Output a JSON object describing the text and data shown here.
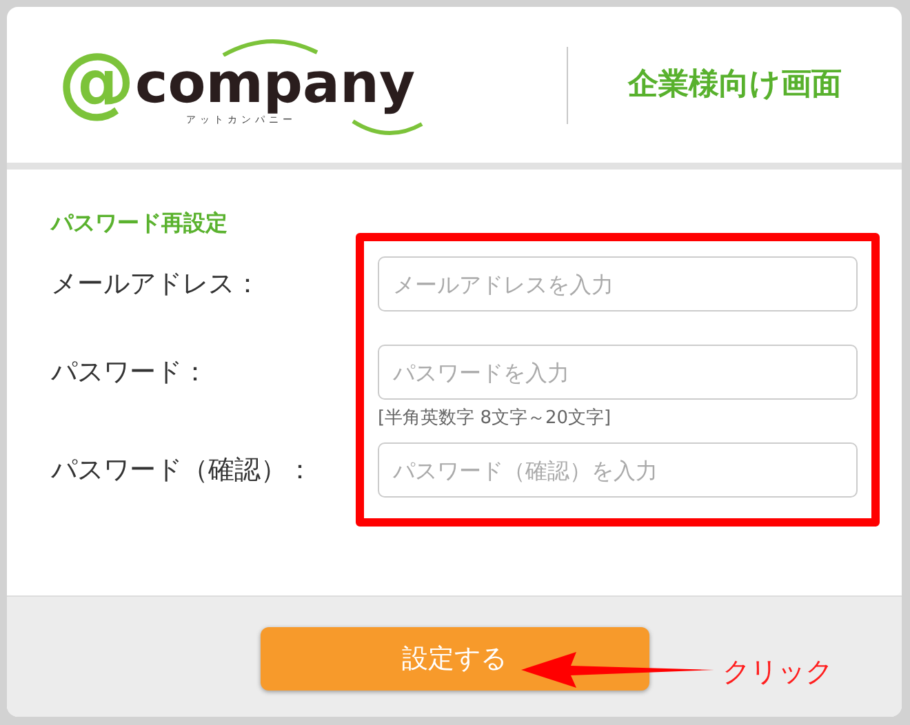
{
  "logo": {
    "mark": "@",
    "name": "company",
    "reading": "アットカンパニー"
  },
  "header_title": "企業様向け画面",
  "form": {
    "heading": "パスワード再設定",
    "fields": [
      {
        "label": "メールアドレス：",
        "placeholder": "メールアドレスを入力"
      },
      {
        "label": "パスワード：",
        "placeholder": "パスワードを入力",
        "hint": "[半角英数字 8文字～20文字]"
      },
      {
        "label": "パスワード（確認）：",
        "placeholder": "パスワード（確認）を入力"
      }
    ]
  },
  "submit_button": "設定する",
  "annotation": {
    "label": "クリック"
  }
}
